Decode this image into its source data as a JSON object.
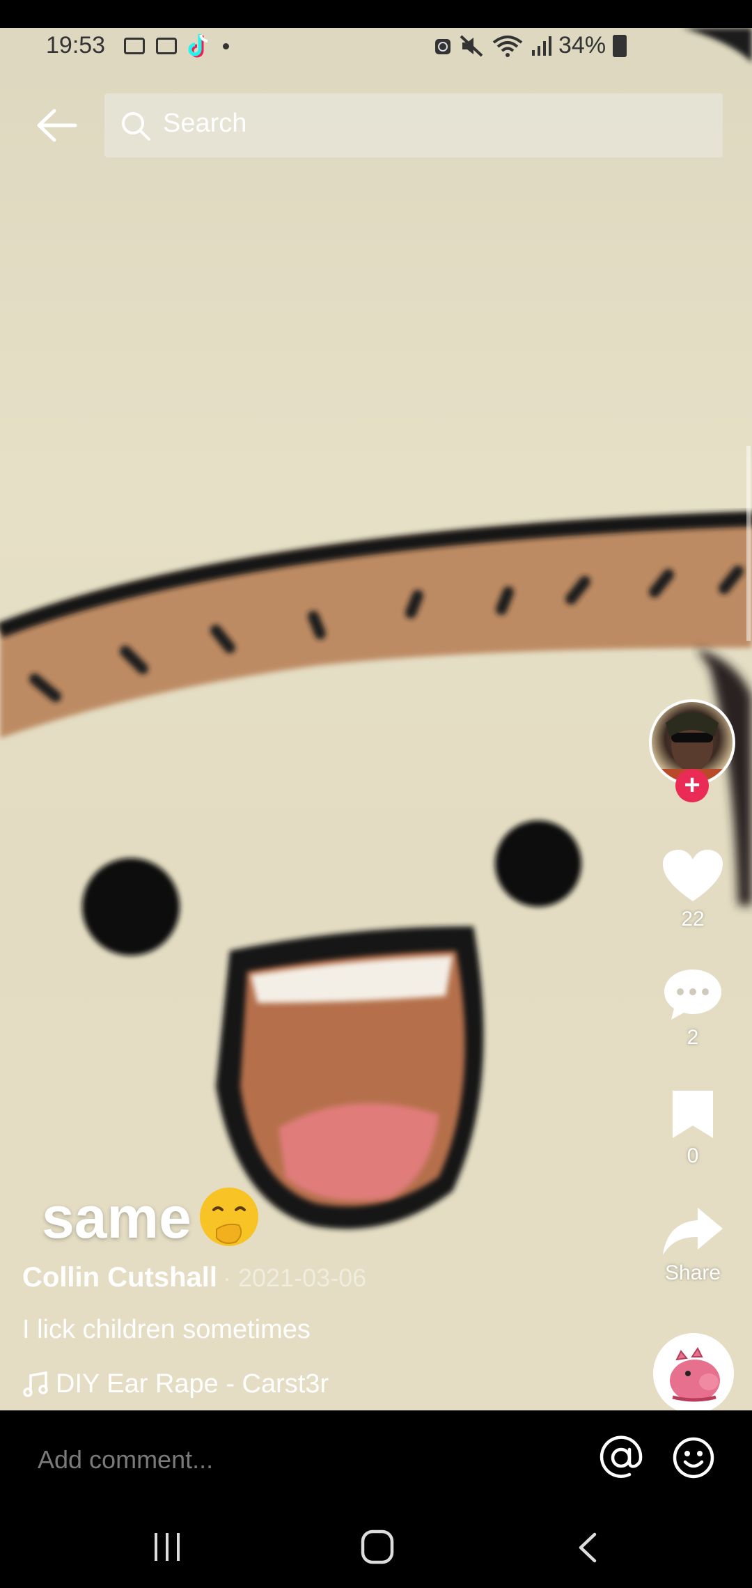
{
  "status_bar": {
    "time": "19:53",
    "battery": "34%"
  },
  "search": {
    "placeholder": "Search"
  },
  "actions": {
    "likes": "22",
    "comments": "2",
    "saves": "0",
    "share_label": "Share"
  },
  "video": {
    "overlay_text": "same",
    "author": "Collin Cutshall",
    "date": "· 2021-03-06",
    "description": "I lick children sometimes",
    "sound": "DIY Ear Rape - Carst3r"
  },
  "comment_bar": {
    "placeholder": "Add comment..."
  },
  "colors": {
    "follow_badge": "#ea2b55",
    "background_tan": "#e3dcc2",
    "band_brown": "#bd8b63"
  },
  "icons": [
    "arrow-left-icon",
    "search-icon",
    "heart-icon",
    "comment-icon",
    "bookmark-icon",
    "share-icon",
    "music-note-icon",
    "at-icon",
    "emoji-icon",
    "recent-apps-icon",
    "home-icon",
    "back-icon"
  ]
}
